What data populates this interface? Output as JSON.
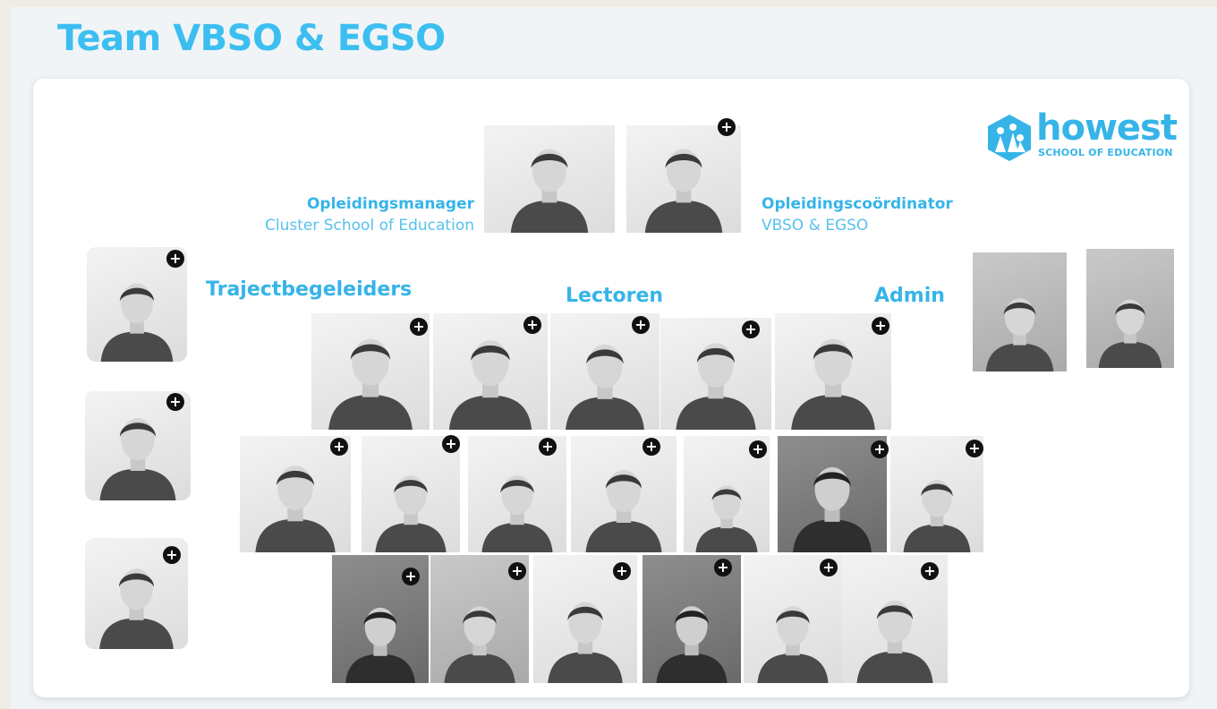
{
  "page": {
    "title": "Team VBSO & EGSO"
  },
  "logo": {
    "brand": "howest",
    "subtitle": "SCHOOL OF EDUCATION"
  },
  "roles": {
    "manager": {
      "title": "Opleidingsmanager",
      "subtitle": "Cluster School of Education"
    },
    "coordinator": {
      "title": "Opleidingscoördinator",
      "subtitle": "VBSO & EGSO"
    }
  },
  "sections": {
    "trajectbegeleiders": "Trajectbegeleiders",
    "lectoren": "Lectoren",
    "admin": "Admin"
  },
  "expand_glyph": "+",
  "colors": {
    "accent": "#36b4e8",
    "title": "#3cbff0",
    "expand_button": "#111111"
  }
}
